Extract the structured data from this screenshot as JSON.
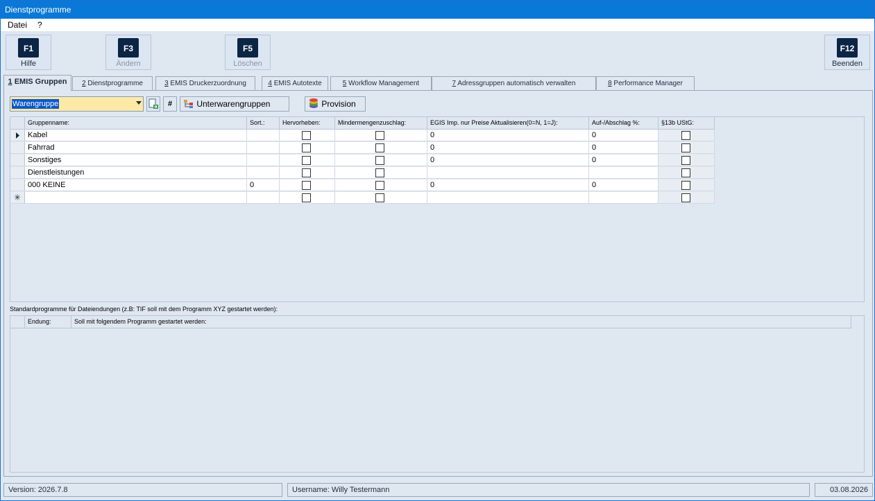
{
  "window": {
    "title": "Dienstprogramme"
  },
  "menu": [
    "Datei",
    "?"
  ],
  "toolbar": {
    "f1": {
      "key": "F1",
      "label": "Hilfe"
    },
    "f3": {
      "key": "F3",
      "label": "Ändern"
    },
    "f5": {
      "key": "F5",
      "label": "Löschen"
    },
    "f12": {
      "key": "F12",
      "label": "Beenden"
    }
  },
  "tabs": [
    {
      "num": "1",
      "label": " EMIS Gruppen"
    },
    {
      "num": "2",
      "label": " Dienstprogramme"
    },
    {
      "num": "3",
      "label": " EMIS Druckerzuordnung"
    },
    {
      "num": "4",
      "label": " EMIS Autotexte"
    },
    {
      "num": "5",
      "label": " Workflow Management"
    },
    {
      "num": "7",
      "label": " Adressgruppen automatisch verwalten"
    },
    {
      "num": "8",
      "label": " Performance Manager"
    }
  ],
  "filter": {
    "combo_value": "Warengruppe",
    "hash_label": "#",
    "unterwarengruppen_label": "Unterwarengruppen",
    "provision_label": "Provision"
  },
  "grid1": {
    "headers": [
      "Gruppenname:",
      "Sort.:",
      "Hervorheben:",
      "Mindermengenzuschlag:",
      "EGIS Imp. nur Preise Aktualisieren(0=N, 1=J):",
      "Auf-/Abschlag %:",
      "§13b UStG:"
    ],
    "rows": [
      {
        "name": "Kabel",
        "sort": "",
        "egis": "0",
        "auf": "0"
      },
      {
        "name": "Fahrrad",
        "sort": "",
        "egis": "0",
        "auf": "0"
      },
      {
        "name": "Sonstiges",
        "sort": "",
        "egis": "0",
        "auf": "0"
      },
      {
        "name": "Dienstleistungen",
        "sort": "",
        "egis": "",
        "auf": ""
      },
      {
        "name": "000 KEINE",
        "sort": "0",
        "egis": "0",
        "auf": "0"
      }
    ],
    "new_row_marker": "✳"
  },
  "section2": {
    "caption": "Standardprogramme für Dateiendungen (z.B: TIF soll mit dem Programm XYZ gestartet werden):",
    "headers": [
      "Endung:",
      "Soll mit folgendem Programm gestartet werden:"
    ]
  },
  "status": {
    "version": "Version: 2026.7.8",
    "username": "Username: Willy Testermann",
    "date": "03.08.2026"
  }
}
